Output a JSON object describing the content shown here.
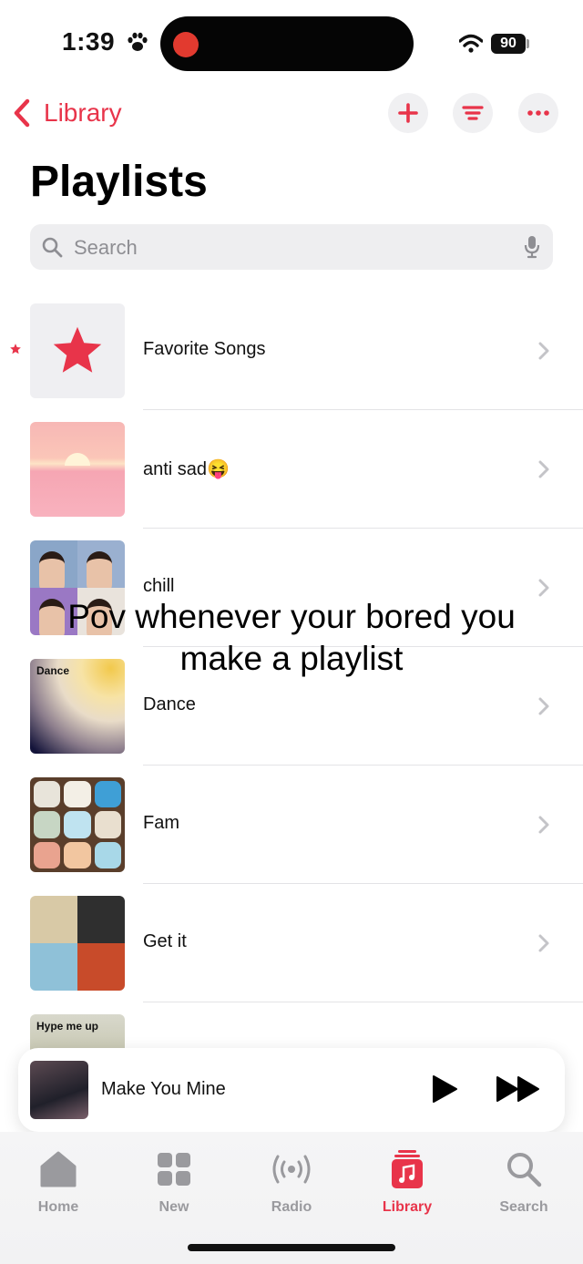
{
  "status": {
    "time": "1:39",
    "battery": "90",
    "paw_icon": "paw-icon",
    "wifi_icon": "wifi-icon"
  },
  "header": {
    "back_label": "Library",
    "title": "Playlists",
    "add_icon": "plus-icon",
    "sort_icon": "sort-lines-icon",
    "more_icon": "ellipsis-icon"
  },
  "search": {
    "placeholder": "Search",
    "value": ""
  },
  "playlists": [
    {
      "label": "Favorite Songs",
      "icon": "star-icon"
    },
    {
      "label": "anti sad😝"
    },
    {
      "label": "chill"
    },
    {
      "label": "Dance",
      "art_text": "Dance"
    },
    {
      "label": "Fam"
    },
    {
      "label": "Get it"
    },
    {
      "label": "",
      "art_text": "Hype me up"
    }
  ],
  "overlay_caption": {
    "line1": "Pov whenever your bored you",
    "line2": "make a playlist"
  },
  "mini_player": {
    "song": "Make You Mine"
  },
  "tabs": [
    {
      "label": "Home",
      "icon": "home-icon"
    },
    {
      "label": "New",
      "icon": "grid-icon"
    },
    {
      "label": "Radio",
      "icon": "radio-icon"
    },
    {
      "label": "Library",
      "icon": "library-icon",
      "active": true
    },
    {
      "label": "Search",
      "icon": "search-icon"
    }
  ],
  "colors": {
    "accent": "#e8344a",
    "inactive_tab": "#9a9a9e"
  }
}
